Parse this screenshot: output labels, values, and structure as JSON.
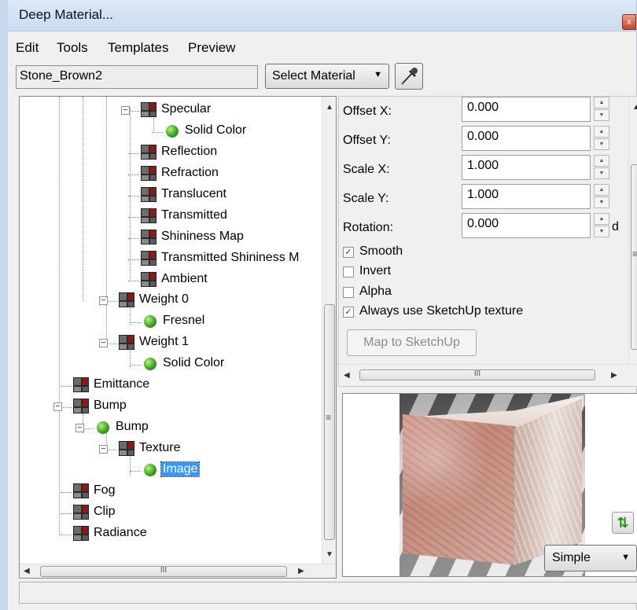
{
  "window": {
    "title": "Deep Material...",
    "close_glyph": "x"
  },
  "menu": {
    "items": [
      "Edit",
      "Tools",
      "Templates",
      "Preview"
    ]
  },
  "material": {
    "name": "Stone_Brown2",
    "select_label": "Select Material",
    "select_arrow": "▼"
  },
  "tree": {
    "nodes": [
      {
        "label": "Specular",
        "icon": "layer-grid-icon"
      },
      {
        "label": "Solid Color",
        "icon": "green-ball-icon"
      },
      {
        "label": "Reflection",
        "icon": "layer-grid-icon"
      },
      {
        "label": "Refraction",
        "icon": "layer-grid-icon"
      },
      {
        "label": "Translucent",
        "icon": "layer-grid-icon"
      },
      {
        "label": "Transmitted",
        "icon": "layer-grid-icon"
      },
      {
        "label": "Shininess Map",
        "icon": "layer-grid-icon"
      },
      {
        "label": "Transmitted Shininess M",
        "icon": "layer-grid-icon"
      },
      {
        "label": "Ambient",
        "icon": "layer-grid-icon"
      },
      {
        "label": "Weight 0",
        "icon": "layer-grid-icon"
      },
      {
        "label": "Fresnel",
        "icon": "green-ball-icon"
      },
      {
        "label": "Weight 1",
        "icon": "layer-grid-icon"
      },
      {
        "label": "Solid Color",
        "icon": "green-ball-icon"
      },
      {
        "label": "Emittance",
        "icon": "layer-grid-icon"
      },
      {
        "label": "Bump",
        "icon": "layer-grid-icon"
      },
      {
        "label": "Bump",
        "icon": "green-ball-icon"
      },
      {
        "label": "Texture",
        "icon": "layer-grid-icon"
      },
      {
        "label": "Image",
        "icon": "green-ball-icon",
        "selected": true
      },
      {
        "label": "Fog",
        "icon": "layer-grid-icon"
      },
      {
        "label": "Clip",
        "icon": "layer-grid-icon"
      },
      {
        "label": "Radiance",
        "icon": "layer-grid-icon"
      }
    ],
    "hscroll_grip": "III",
    "vscroll_grip": "≡"
  },
  "props": {
    "offset_x": {
      "label": "Offset X:",
      "value": "0.000"
    },
    "offset_y": {
      "label": "Offset Y:",
      "value": "0.000"
    },
    "scale_x": {
      "label": "Scale X:",
      "value": "1.000"
    },
    "scale_y": {
      "label": "Scale Y:",
      "value": "1.000"
    },
    "rotation": {
      "label": "Rotation:",
      "value": "0.000",
      "unit": "d"
    },
    "smooth": {
      "label": "Smooth",
      "checked": true
    },
    "invert": {
      "label": "Invert",
      "checked": false
    },
    "alpha": {
      "label": "Alpha",
      "checked": false
    },
    "always_use": {
      "label": "Always use SketchUp texture",
      "checked": true
    },
    "map_button": "Map to SketchUp",
    "hscroll_grip": "III",
    "vscroll_grip": "≡"
  },
  "preview": {
    "mode": "Simple",
    "mode_arrow": "▼",
    "refresh_glyph": "⇅"
  },
  "colors": {
    "selection": "#3399ff",
    "window_bg": "#f0f0f0",
    "title_bar": "#c9dcf1"
  }
}
